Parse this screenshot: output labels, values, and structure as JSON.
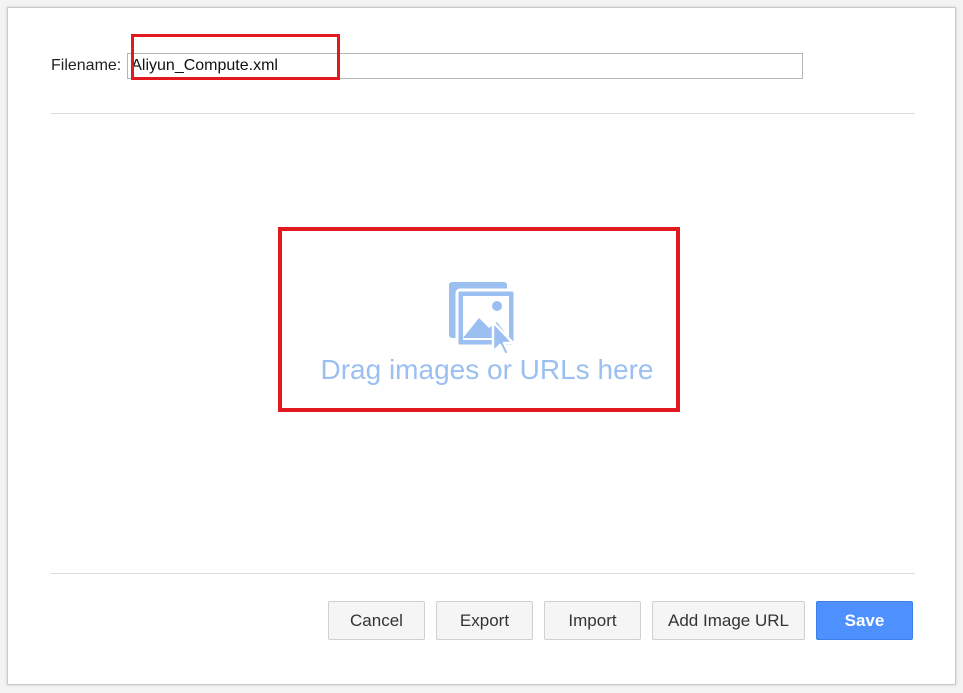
{
  "filename": {
    "label": "Filename:",
    "value": "Aliyun_Compute.xml"
  },
  "dropzone": {
    "icon": "image-drop-icon",
    "text": "Drag images or URLs here"
  },
  "buttons": {
    "cancel": "Cancel",
    "export": "Export",
    "import": "Import",
    "add_image_url": "Add Image URL",
    "save": "Save"
  },
  "colors": {
    "accent": "#4d90fe",
    "highlight": "#e2191f",
    "drop_text": "#9bbff1"
  }
}
